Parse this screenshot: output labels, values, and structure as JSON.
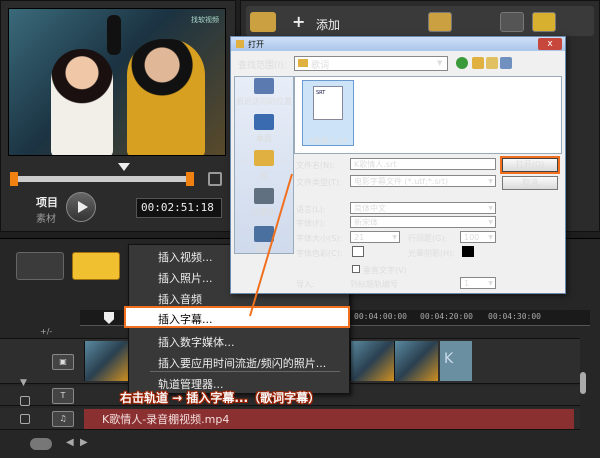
{
  "preview": {
    "watermark": "找软视频",
    "mode_project": "项目",
    "mode_clip": "素材",
    "timecode": "00:02:51:18"
  },
  "library": {
    "add_label": "添加",
    "add_symbol": "+"
  },
  "timeline": {
    "ruler_ticks": [
      "00:04:00:00",
      "00:04:20:00",
      "00:04:30:00"
    ],
    "video_clip_tail": "K",
    "title_track_icon": "T",
    "music_track_icon": "♫",
    "audio_clip_label": "K歌情人-录音棚视频.mp4",
    "track_add_label": "+/-"
  },
  "context_menu": {
    "items": [
      "插入视频...",
      "插入照片...",
      "插入音频",
      "插入字幕...",
      "插入数字媒体...",
      "插入要应用时间流逝/频闪的照片...",
      "轨道管理器..."
    ]
  },
  "dialog": {
    "title": "打开",
    "close_label": "x",
    "lookin_label": "查找范围(I):",
    "lookin_value": "歌词",
    "places": [
      "最近访问的位置",
      "桌面",
      "库",
      "计算机",
      "网络"
    ],
    "file_badge": "SRT",
    "file_name": "K歌情人.srt",
    "filename_label": "文件名(N):",
    "filename_value": "K歌情人.srt",
    "filetype_label": "文件类型(T):",
    "filetype_value": "电影字幕文件 (*.utf;*.srt)",
    "open_label": "打开(O)",
    "cancel_label": "取消",
    "language_label": "语言(L):",
    "language_value": "简体中文",
    "font_label": "字体(F):",
    "font_value": "新宋体",
    "fontsize_label": "字体大小(S):",
    "fontsize_value": "21",
    "linespacing_label": "行间距(G):",
    "linespacing_value": "100",
    "fontcolor_label": "字体色彩(C):",
    "shadow_label": "光晕阴影(H):",
    "vertical_label": "垂直文字(V)",
    "import_label": "导入:",
    "import_option": "到标题轨编号",
    "import_track": "1"
  },
  "annotation": {
    "text": "右击轨道 → 插入字幕...（歌词字幕）",
    "color": "#f07020"
  }
}
